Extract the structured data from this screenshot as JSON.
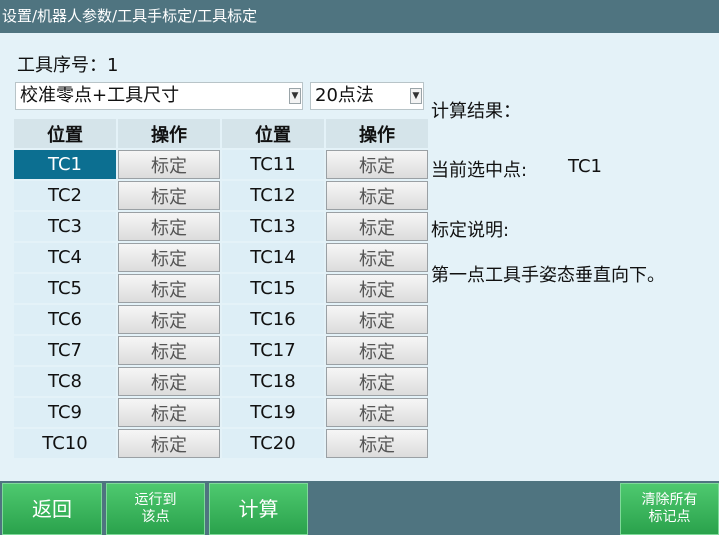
{
  "window": {
    "title": "设置/机器人参数/工具手标定/工具标定"
  },
  "tool_number": {
    "label": "工具序号：1"
  },
  "method_select": {
    "value": "校准零点+工具尺寸"
  },
  "points_select": {
    "value": "20点法"
  },
  "table": {
    "headers": [
      "位置",
      "操作",
      "位置",
      "操作"
    ],
    "calibrate_label": "标定",
    "left": [
      "TC1",
      "TC2",
      "TC3",
      "TC4",
      "TC5",
      "TC6",
      "TC7",
      "TC8",
      "TC9",
      "TC10"
    ],
    "right": [
      "TC11",
      "TC12",
      "TC13",
      "TC14",
      "TC15",
      "TC16",
      "TC17",
      "TC18",
      "TC19",
      "TC20"
    ],
    "selected": "TC1"
  },
  "results": {
    "calc_label": "计算结果：",
    "selected_label": "当前选中点:",
    "selected_value": "TC1",
    "note_label": "标定说明:",
    "note_text": "第一点工具手姿态垂直向下。"
  },
  "buttons": {
    "back": "返回",
    "run_to_line1": "运行到",
    "run_to_line2": "该点",
    "calc": "计算",
    "clear_line1": "清除所有",
    "clear_line2": "标记点"
  },
  "colors": {
    "titlebar": "#4f7480",
    "selected_cell": "#0c6f91",
    "button_green": "#3bb55d"
  }
}
